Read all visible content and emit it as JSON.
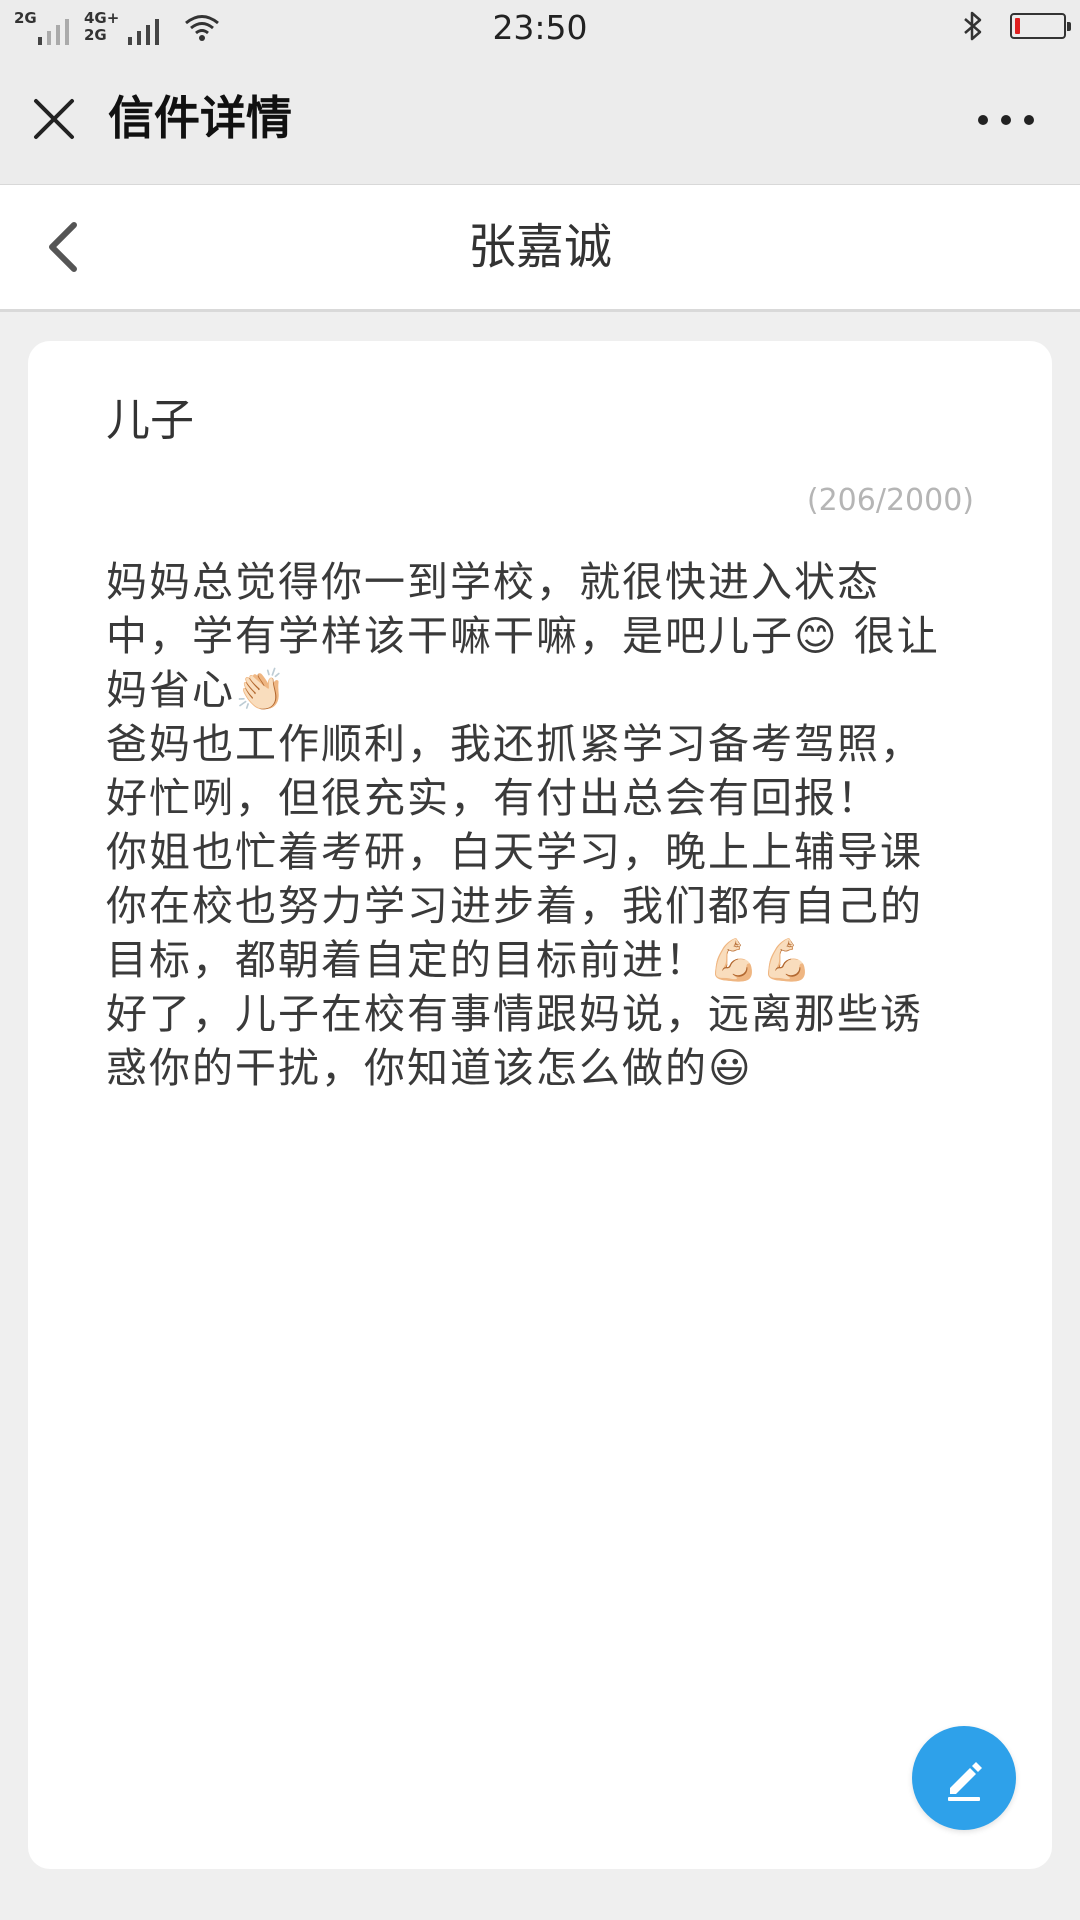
{
  "status_bar": {
    "network1": "2G",
    "network2_top": "4G+",
    "network2_bottom": "2G",
    "time": "23:50",
    "battery_level": 0.1
  },
  "nav": {
    "title": "信件详情"
  },
  "sub_header": {
    "title": "张嘉诚"
  },
  "letter": {
    "salutation": "儿子",
    "char_count": "(206/2000)",
    "paragraphs": [
      "妈妈总觉得你一到学校，就很快进入状态中，学有学样该干嘛干嘛，是吧儿子😊 很让妈省心👏🏻",
      "爸妈也工作顺利，我还抓紧学习备考驾照，好忙咧，但很充实，有付出总会有回报！",
      "你姐也忙着考研，白天学习，晚上上辅导课",
      "你在校也努力学习进步着，我们都有自己的目标，都朝着自定的目标前进！💪🏻💪🏻",
      "好了，儿子在校有事情跟妈说，远离那些诱惑你的干扰，你知道该怎么做的😃"
    ]
  },
  "colors": {
    "accent": "#2ea1ea",
    "header_bg": "#ececec",
    "page_bg": "#efefef",
    "battery_low": "#e02020"
  },
  "icons": {
    "close": "close-icon",
    "more": "more-icon",
    "back": "chevron-left-icon",
    "edit": "edit-pencil-icon",
    "bluetooth": "bluetooth-icon",
    "wifi": "wifi-icon"
  }
}
